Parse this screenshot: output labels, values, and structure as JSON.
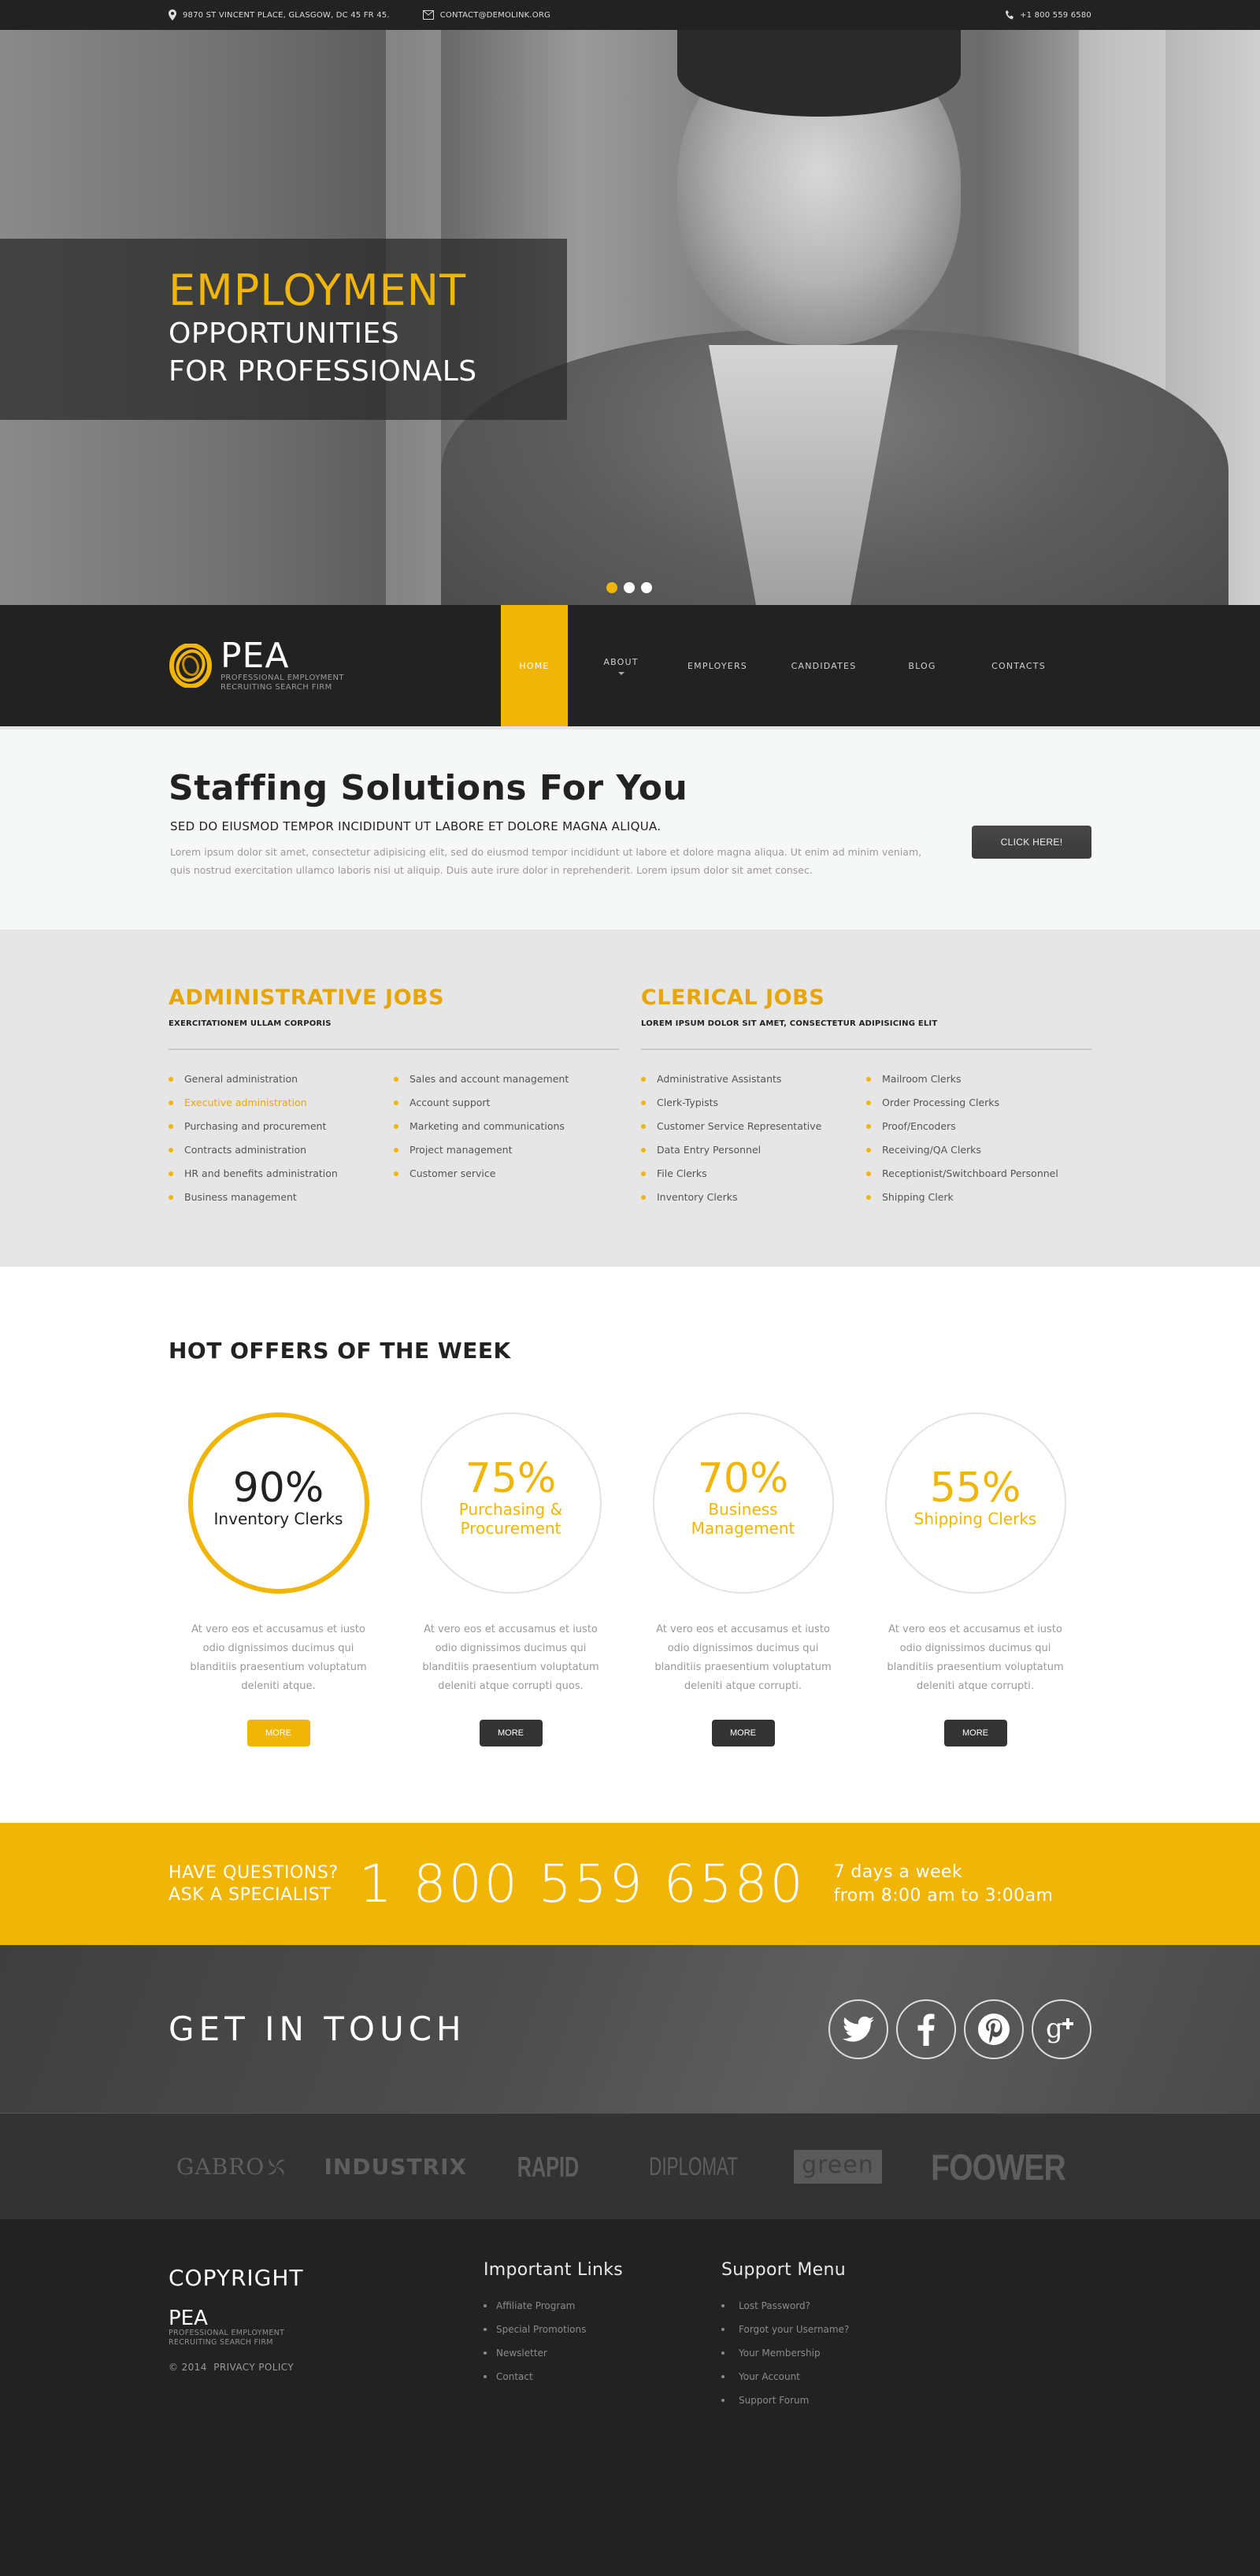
{
  "topbar": {
    "address": "9870 ST VINCENT PLACE, GLASGOW, DC 45 FR 45.",
    "email": "CONTACT@DEMOLINK.ORG",
    "phone": "+1 800 559 6580"
  },
  "hero": {
    "line1": "EMPLOYMENT",
    "line2": "OPPORTUNITIES",
    "line3": "FOR PROFESSIONALS",
    "slides": {
      "count": 3,
      "active_index": 0
    }
  },
  "brand": {
    "name": "PEA",
    "tagline_1": "PROFESSIONAL EMPLOYMENT",
    "tagline_2": "RECRUITING SEARCH FIRM",
    "accent_color": "#f1b506"
  },
  "nav": {
    "items": [
      {
        "label": "HOME",
        "active": true
      },
      {
        "label": "ABOUT",
        "has_dropdown": true
      },
      {
        "label": "EMPLOYERS"
      },
      {
        "label": "CANDIDATES"
      },
      {
        "label": "BLOG"
      },
      {
        "label": "CONTACTS"
      }
    ]
  },
  "staffing": {
    "title": "Staffing Solutions For You",
    "subtitle": "SED DO EIUSMOD TEMPOR INCIDIDUNT UT LABORE ET DOLORE MAGNA ALIQUA.",
    "body": "Lorem ipsum dolor sit amet, consectetur adipisicing elit, sed do eiusmod tempor incididunt ut labore et dolore magna aliqua. Ut enim ad minim veniam, quis nostrud exercitation ullamco laboris nisi ut aliquip. Duis aute irure dolor in reprehenderit. Lorem ipsum dolor sit amet consec.",
    "cta_label": "CLICK HERE!"
  },
  "jobs": {
    "administrative": {
      "title": "ADMINISTRATIVE JOBS",
      "subtitle": "EXERCITATIONEM ULLAM CORPORIS",
      "col1": [
        "General administration",
        "Executive administration",
        "Purchasing and procurement",
        "Contracts administration",
        "HR and benefits administration",
        "Business management"
      ],
      "col2": [
        "Sales and account management",
        "Account support",
        "Marketing and communications",
        "Project management",
        "Customer service"
      ],
      "highlighted": "Executive administration"
    },
    "clerical": {
      "title": "CLERICAL JOBS",
      "subtitle": "LOREM IPSUM DOLOR SIT AMET, CONSECTETUR ADIPISICING ELIT",
      "col1": [
        "Administrative Assistants",
        "Clerk-Typists",
        "Customer Service Representative",
        "Data Entry Personnel",
        "File Clerks",
        "Inventory Clerks"
      ],
      "col2": [
        "Mailroom Clerks",
        "Order Processing Clerks",
        "Proof/Encoders",
        "Receiving/QA Clerks",
        "Receptionist/Switchboard Personnel",
        "Shipping Clerk"
      ]
    }
  },
  "offers": {
    "title": "HOT OFFERS OF THE WEEK",
    "items": [
      {
        "percent": "90%",
        "label": "Inventory Clerks",
        "description": "At vero eos et accusamus et iusto odio dignissimos ducimus qui blanditiis praesentium voluptatum deleniti atque.",
        "button": "MORE",
        "active": true
      },
      {
        "percent": "75%",
        "label": "Purchasing & Procurement",
        "description": "At vero eos et accusamus et iusto odio dignissimos ducimus qui blanditiis praesentium voluptatum deleniti atque corrupti quos.",
        "button": "MORE"
      },
      {
        "percent": "70%",
        "label": "Business Management",
        "description": "At vero eos et accusamus et iusto odio dignissimos ducimus qui blanditiis praesentium voluptatum deleniti atque corrupti.",
        "button": "MORE"
      },
      {
        "percent": "55%",
        "label": "Shipping Clerks",
        "description": "At vero eos et accusamus et iusto odio dignissimos ducimus qui blanditiis praesentium voluptatum deleniti atque corrupti.",
        "button": "MORE"
      }
    ]
  },
  "call": {
    "question_1": "HAVE QUESTIONS?",
    "question_2": "ASK A SPECIALIST",
    "number": "1 800 559 6580",
    "hours_1": "7 days a week",
    "hours_2": "from 8:00 am to 3:00am"
  },
  "touch": {
    "title": "GET IN TOUCH",
    "socials": [
      "twitter-icon",
      "facebook-icon",
      "pinterest-icon",
      "google-plus-icon"
    ]
  },
  "partners": [
    "GABRO",
    "INDUSTRIX",
    "RAPID",
    "DIPLOMAT",
    "green",
    "FOOWER"
  ],
  "footer": {
    "copyright_title": "COPYRIGHT",
    "brand_name": "PEA",
    "tagline_1": "PROFESSIONAL EMPLOYMENT",
    "tagline_2": "RECRUITING SEARCH FIRM",
    "year": "© 2014",
    "privacy": "PRIVACY POLICY",
    "important_links": {
      "title": "Important Links",
      "items": [
        "Affiliate Program",
        "Special Promotions",
        "Newsletter",
        "Contact"
      ]
    },
    "support_menu": {
      "title": "Support Menu",
      "items": [
        "Lost Password?",
        "Forgot your Username?",
        "Your Membership",
        "Your Account",
        "Support Forum"
      ]
    }
  }
}
